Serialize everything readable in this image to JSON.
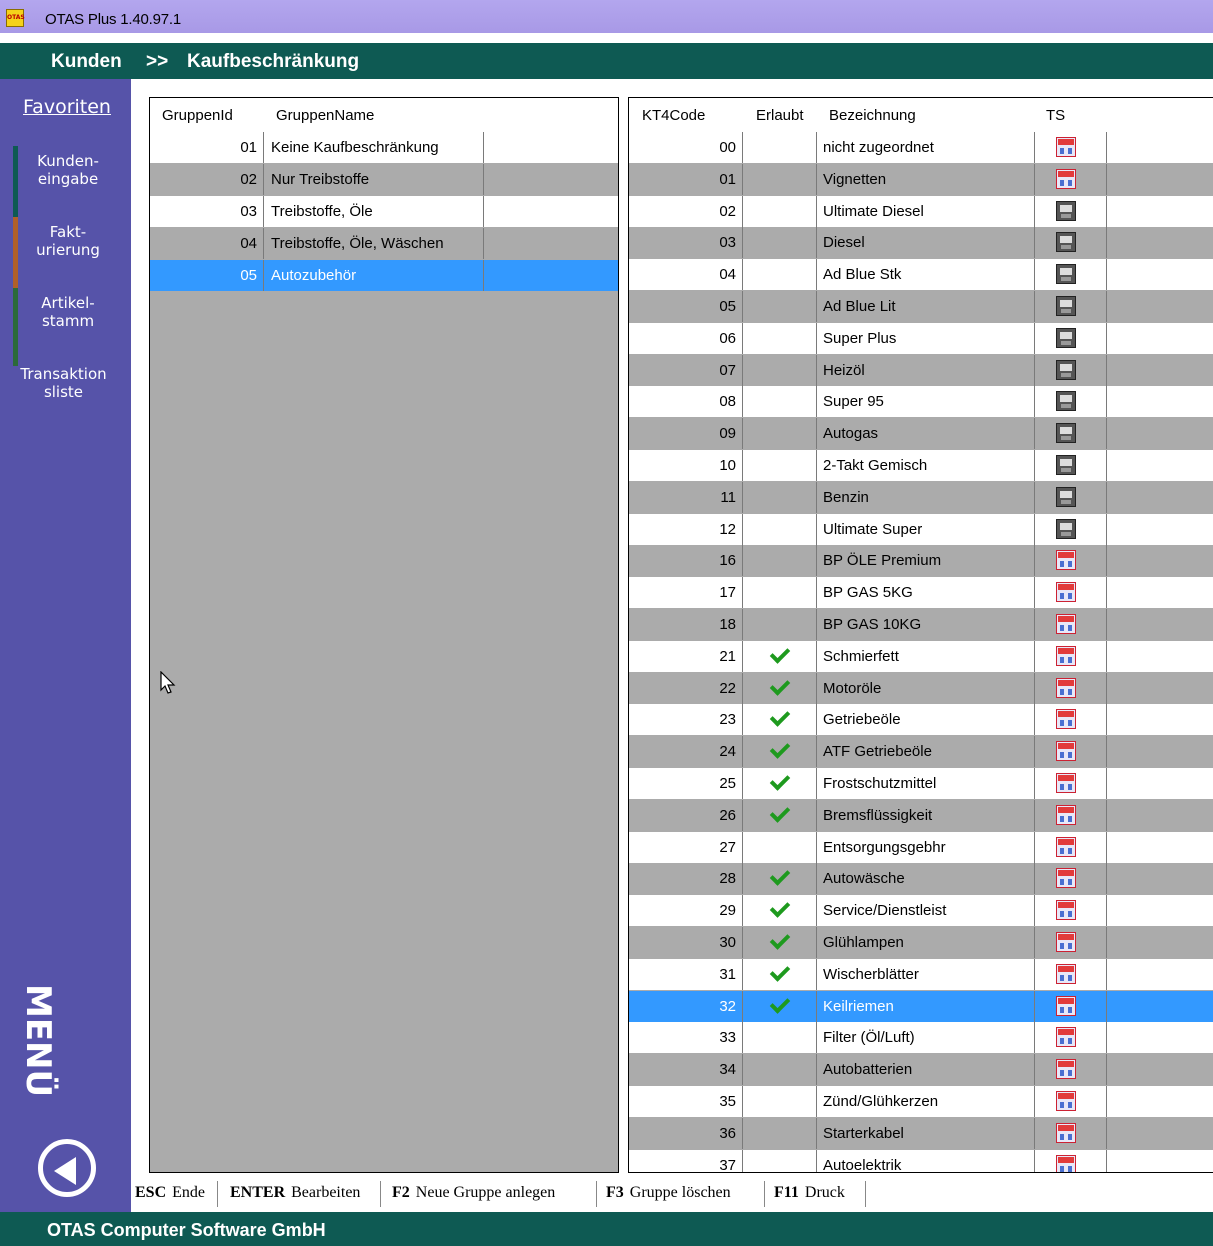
{
  "window": {
    "title": "OTAS Plus 1.40.97.1",
    "icon": "otas-app-icon"
  },
  "breadcrumb": {
    "root": "Kunden",
    "sep": ">>",
    "current": "Kaufbeschränkung"
  },
  "sidebar": {
    "favorites": "Favoriten",
    "items": [
      {
        "label1": "Kunden-",
        "label2": "eingabe",
        "accent": "#0e5a53"
      },
      {
        "label1": "Fakt-",
        "label2": "urierung",
        "accent": "#b0602a"
      },
      {
        "label1": "Artikel-",
        "label2": "stamm",
        "accent": "#2b6a3a"
      },
      {
        "label1": "Transaktion",
        "label2": "sliste",
        "accent": ""
      }
    ],
    "menu_label": "MENÜ",
    "back_icon": "back-arrow-circle-icon"
  },
  "groups": {
    "headers": {
      "id": "GruppenId",
      "name": "GruppenName"
    },
    "rows": [
      {
        "id": "01",
        "name": "Keine Kaufbeschränkung"
      },
      {
        "id": "02",
        "name": "Nur Treibstoffe"
      },
      {
        "id": "03",
        "name": "Treibstoffe, Öle"
      },
      {
        "id": "04",
        "name": "Treibstoffe, Öle, Wäschen"
      },
      {
        "id": "05",
        "name": "Autozubehör"
      }
    ],
    "selected_index": 4
  },
  "codes": {
    "headers": {
      "code": "KT4Code",
      "allowed": "Erlaubt",
      "name": "Bezeichnung",
      "ts": "TS"
    },
    "rows": [
      {
        "code": "00",
        "allowed": false,
        "name": "nicht zugeordnet",
        "ts": "shop"
      },
      {
        "code": "01",
        "allowed": false,
        "name": "Vignetten",
        "ts": "shop"
      },
      {
        "code": "02",
        "allowed": false,
        "name": "Ultimate Diesel",
        "ts": "oil"
      },
      {
        "code": "03",
        "allowed": false,
        "name": "Diesel",
        "ts": "oil"
      },
      {
        "code": "04",
        "allowed": false,
        "name": "Ad Blue Stk",
        "ts": "oil"
      },
      {
        "code": "05",
        "allowed": false,
        "name": "Ad Blue Lit",
        "ts": "oil"
      },
      {
        "code": "06",
        "allowed": false,
        "name": "Super Plus",
        "ts": "oil"
      },
      {
        "code": "07",
        "allowed": false,
        "name": "Heizöl",
        "ts": "oil"
      },
      {
        "code": "08",
        "allowed": false,
        "name": "Super 95",
        "ts": "oil"
      },
      {
        "code": "09",
        "allowed": false,
        "name": "Autogas",
        "ts": "oil"
      },
      {
        "code": "10",
        "allowed": false,
        "name": "2-Takt Gemisch",
        "ts": "oil"
      },
      {
        "code": "11",
        "allowed": false,
        "name": "Benzin",
        "ts": "oil"
      },
      {
        "code": "12",
        "allowed": false,
        "name": "Ultimate Super",
        "ts": "oil"
      },
      {
        "code": "16",
        "allowed": false,
        "name": "BP ÖLE Premium",
        "ts": "shop"
      },
      {
        "code": "17",
        "allowed": false,
        "name": "BP GAS 5KG",
        "ts": "shop"
      },
      {
        "code": "18",
        "allowed": false,
        "name": "BP GAS 10KG",
        "ts": "shop"
      },
      {
        "code": "21",
        "allowed": true,
        "name": "Schmierfett",
        "ts": "shop"
      },
      {
        "code": "22",
        "allowed": true,
        "name": "Motoröle",
        "ts": "shop"
      },
      {
        "code": "23",
        "allowed": true,
        "name": "Getriebeöle",
        "ts": "shop"
      },
      {
        "code": "24",
        "allowed": true,
        "name": "ATF Getriebeöle",
        "ts": "shop"
      },
      {
        "code": "25",
        "allowed": true,
        "name": "Frostschutzmittel",
        "ts": "shop"
      },
      {
        "code": "26",
        "allowed": true,
        "name": "Bremsflüssigkeit",
        "ts": "shop"
      },
      {
        "code": "27",
        "allowed": false,
        "name": "Entsorgungsgebhr",
        "ts": "shop"
      },
      {
        "code": "28",
        "allowed": true,
        "name": "Autowäsche",
        "ts": "shop"
      },
      {
        "code": "29",
        "allowed": true,
        "name": "Service/Dienstleist",
        "ts": "shop"
      },
      {
        "code": "30",
        "allowed": true,
        "name": "Glühlampen",
        "ts": "shop"
      },
      {
        "code": "31",
        "allowed": true,
        "name": "Wischerblätter",
        "ts": "shop"
      },
      {
        "code": "32",
        "allowed": true,
        "name": "Keilriemen",
        "ts": "shop"
      },
      {
        "code": "33",
        "allowed": false,
        "name": "Filter (Öl/Luft)",
        "ts": "shop"
      },
      {
        "code": "34",
        "allowed": false,
        "name": "Autobatterien",
        "ts": "shop"
      },
      {
        "code": "35",
        "allowed": false,
        "name": "Zünd/Glühkerzen",
        "ts": "shop"
      },
      {
        "code": "36",
        "allowed": false,
        "name": "Starterkabel",
        "ts": "shop"
      },
      {
        "code": "37",
        "allowed": false,
        "name": "Autoelektrik",
        "ts": "shop"
      }
    ],
    "selected_code": "32"
  },
  "hotkeys": [
    {
      "key": "ESC",
      "label": "Ende"
    },
    {
      "key": "ENTER",
      "label": "Bearbeiten"
    },
    {
      "key": "F2",
      "label": "Neue Gruppe anlegen"
    },
    {
      "key": "F3",
      "label": "Gruppe löschen"
    },
    {
      "key": "F11",
      "label": "Druck"
    }
  ],
  "status": {
    "company": "OTAS Computer Software GmbH"
  },
  "colors": {
    "header_bg": "#0e5a53",
    "sidebar_bg": "#5653a9",
    "select_bg": "#3399ff",
    "row_gray": "#ababab"
  }
}
